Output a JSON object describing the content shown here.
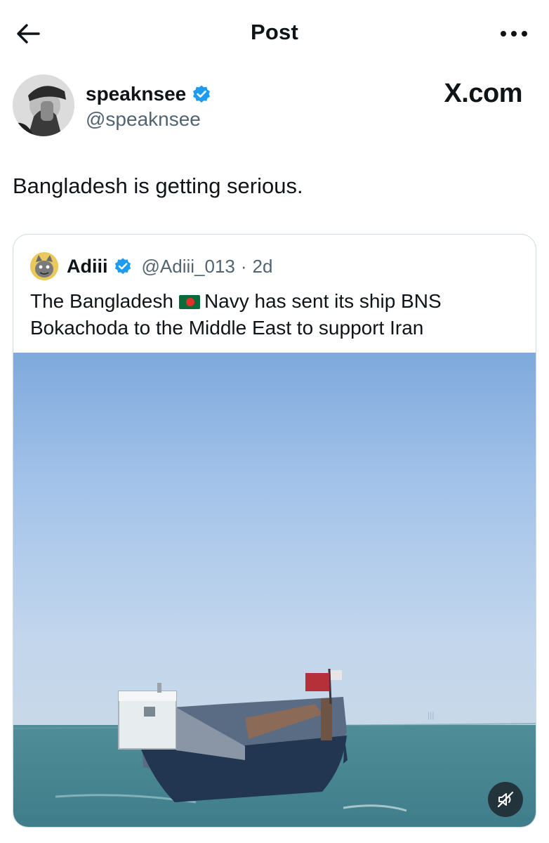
{
  "header": {
    "title": "Post",
    "back_icon": "arrow-left-icon",
    "more_icon": "more-horizontal-icon"
  },
  "author": {
    "name": "speaknsee",
    "handle": "@speaknsee",
    "verified": true,
    "verified_color": "#1d9bf0"
  },
  "brand": {
    "label": "X.com"
  },
  "post": {
    "text": "Bangladesh is getting serious."
  },
  "quote": {
    "name": "Adiii",
    "handle": "@Adiii_013",
    "separator": "·",
    "time": "2d",
    "verified": true,
    "text_before_flag": "The Bangladesh",
    "flag_icon": "bangladesh-flag-icon",
    "text_after_flag": "Navy has sent its ship BNS Bokachoda to the Middle East to support Iran"
  },
  "media": {
    "kind": "video",
    "mute_icon": "volume-muted-icon"
  },
  "colors": {
    "text": "#0f1419",
    "secondary": "#536471",
    "border": "#cfd9de",
    "accent": "#1d9bf0"
  }
}
